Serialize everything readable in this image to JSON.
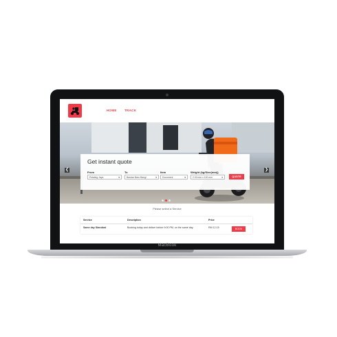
{
  "device": {
    "brand_label": "MacBook"
  },
  "nav": {
    "home": "HOME",
    "track": "TRACK"
  },
  "hero": {
    "prev_arrow": "❮",
    "next_arrow": "❯",
    "slide_count": 3,
    "active_slide": 1
  },
  "quote": {
    "title": "Get instant quote",
    "from_label": "From",
    "from_value": "Petaling Jaya",
    "to_label": "To",
    "to_value": "Bandar Baru Bangi",
    "item_label": "Item",
    "item_value": "Document",
    "weight_label": "Weight (kg/Size(mm))",
    "weight_value": "2.00 mm x 100 mm",
    "button": "QUOTE"
  },
  "notice": "Please select a Service",
  "services_table": {
    "headers": [
      "Service",
      "Description",
      "Price",
      ""
    ],
    "rows": [
      {
        "service": "Same day Standard",
        "description": "Booking today and deliver before 9:00 PM, on the same day.",
        "price": "RM 12.15",
        "action": "BOOK"
      }
    ]
  },
  "colors": {
    "accent": "#f03a47",
    "bezel": "#111214"
  }
}
